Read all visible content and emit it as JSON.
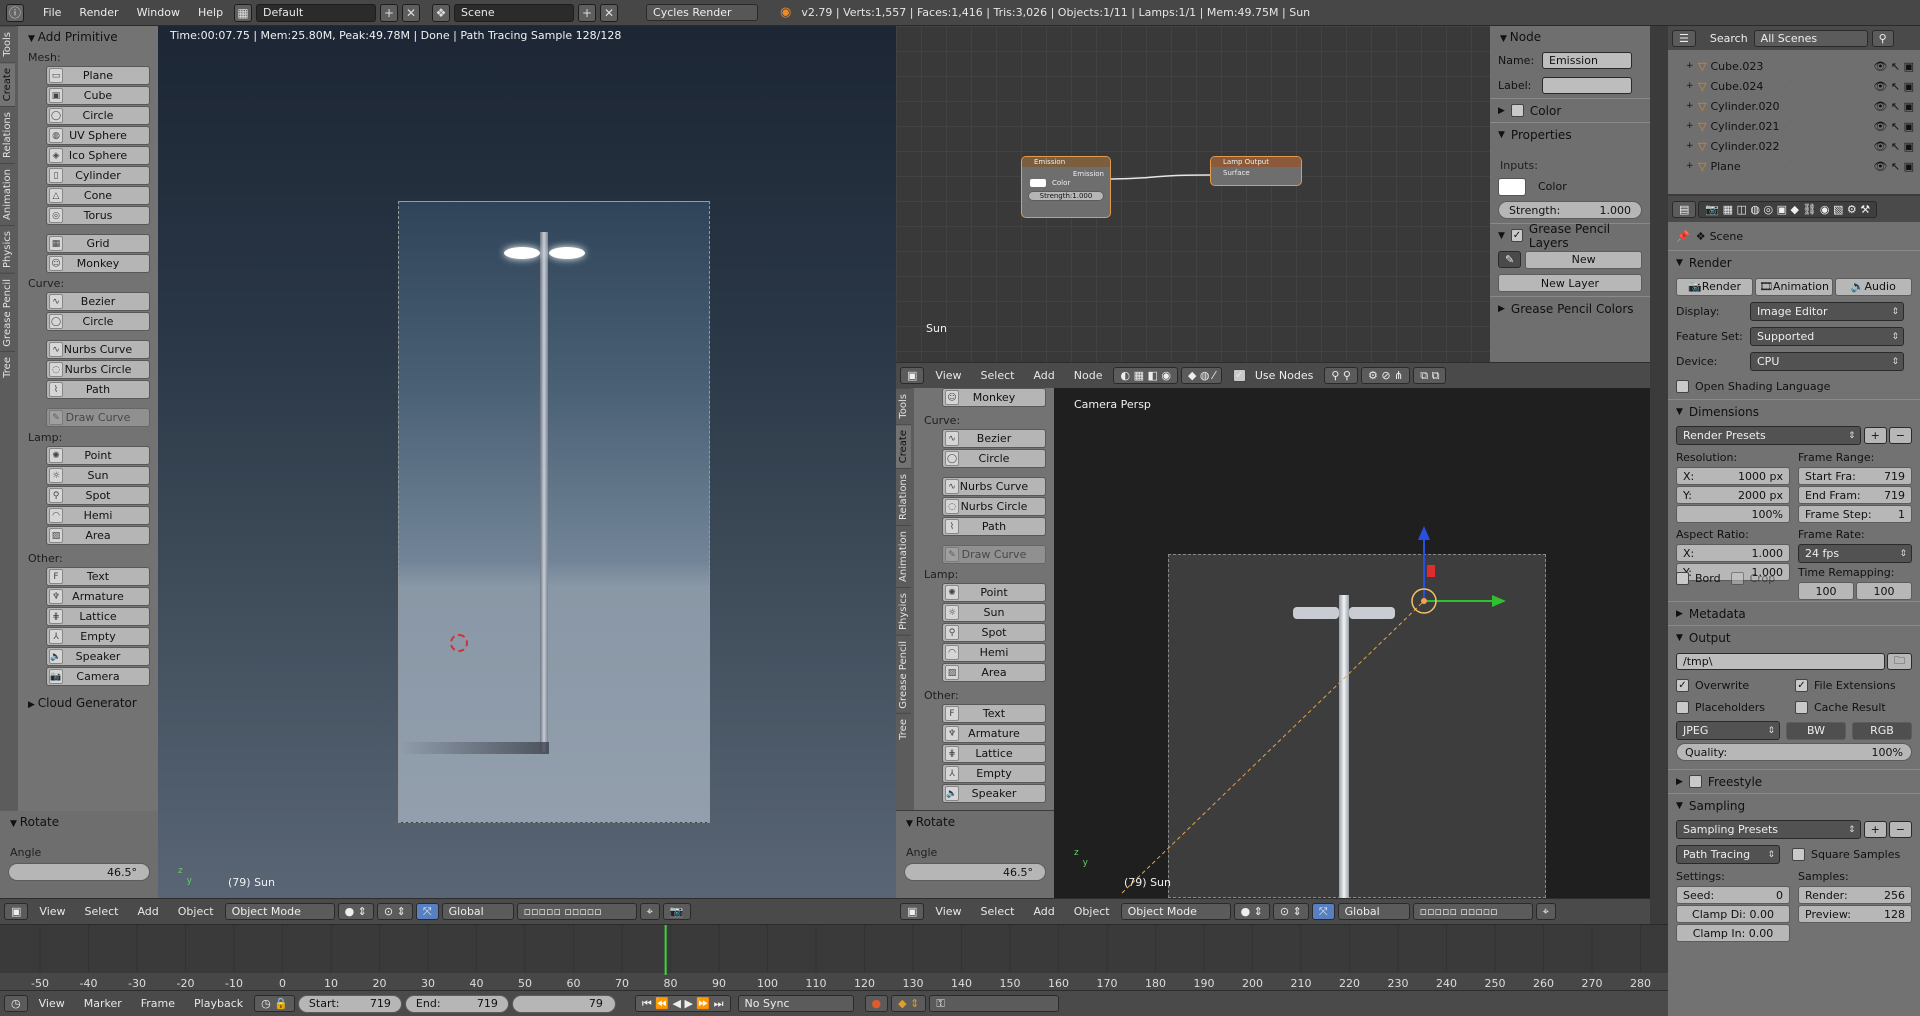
{
  "topbar": {
    "menus": [
      "File",
      "Render",
      "Window",
      "Help"
    ],
    "screen_layout": "Default",
    "scene": "Scene",
    "engine": "Cycles Render",
    "stats": "v2.79 | Verts:1,557 | Faces:1,416 | Tris:3,026 | Objects:1/11 | Lamps:1/1 | Mem:49.75M | Sun"
  },
  "left_tool_tabs": [
    "Tools",
    "Create",
    "Relations",
    "Animation",
    "Physics",
    "Grease Pencil",
    "Tree"
  ],
  "tool_panel": {
    "title": "Add Primitive",
    "mesh_label": "Mesh:",
    "mesh": [
      "Plane",
      "Cube",
      "Circle",
      "UV Sphere",
      "Ico Sphere",
      "Cylinder",
      "Cone",
      "Torus"
    ],
    "mesh2": [
      "Grid",
      "Monkey"
    ],
    "curve_label": "Curve:",
    "curve": [
      "Bezier",
      "Circle"
    ],
    "curve2": [
      "Nurbs Curve",
      "Nurbs Circle",
      "Path"
    ],
    "draw_curve": "Draw Curve",
    "lamp_label": "Lamp:",
    "lamp": [
      "Point",
      "Sun",
      "Spot",
      "Hemi",
      "Area"
    ],
    "other_label": "Other:",
    "other": [
      "Text",
      "Armature",
      "Lattice",
      "Empty",
      "Speaker",
      "Camera"
    ],
    "cloud": "Cloud Generator"
  },
  "rotate_panel": {
    "title": "Rotate",
    "angle_label": "Angle",
    "angle_value": "46.5°"
  },
  "render_view": {
    "status": "Time:00:07.75 | Mem:25.80M, Peak:49.78M | Done | Path Tracing Sample 128/128",
    "object_label": "(79) Sun"
  },
  "left_header": {
    "menus": [
      "View",
      "Select",
      "Add",
      "Object"
    ],
    "mode": "Object Mode",
    "orientation": "Global"
  },
  "node_editor": {
    "emission_node": {
      "title": "Emission",
      "output": "Emission",
      "color_label": "Color",
      "strength": "Strength:1.000"
    },
    "lamp_output": {
      "title": "Lamp Output",
      "input": "Surface"
    },
    "label": "Sun"
  },
  "node_side": {
    "node_title": "Node",
    "name_label": "Name:",
    "name_value": "Emission",
    "label_label": "Label:",
    "label_value": "",
    "color_section": "Color",
    "properties_section": "Properties",
    "inputs_label": "Inputs:",
    "color_label": "Color",
    "strength": "Strength:",
    "strength_value": "1.000",
    "gp_layers": "Grease Pencil Layers",
    "new_btn": "New",
    "new_layer_btn": "New Layer",
    "gp_colors": "Grease Pencil Colors"
  },
  "node_header": {
    "menus": [
      "View",
      "Select",
      "Add",
      "Node"
    ],
    "use_nodes": "Use Nodes"
  },
  "mid_tool_tabs": [
    "Tools",
    "Create",
    "Relations",
    "Animation",
    "Physics",
    "Grease Pencil",
    "Tree"
  ],
  "mid_tool_panel": {
    "monkey": "Monkey",
    "curve_label": "Curve:",
    "curve": [
      "Bezier",
      "Circle"
    ],
    "curve2": [
      "Nurbs Curve",
      "Nurbs Circle",
      "Path"
    ],
    "draw_curve": "Draw Curve",
    "lamp_label": "Lamp:",
    "lamp": [
      "Point",
      "Sun",
      "Spot",
      "Hemi",
      "Area"
    ],
    "other_label": "Other:",
    "other": [
      "Text",
      "Armature",
      "Lattice",
      "Empty",
      "Speaker"
    ]
  },
  "camera_view": {
    "label": "Camera Persp",
    "object_label": "(79) Sun"
  },
  "mid_rotate": {
    "title": "Rotate",
    "angle_label": "Angle",
    "angle_value": "46.5°"
  },
  "mid_header": {
    "menus": [
      "View",
      "Select",
      "Add",
      "Object"
    ],
    "mode": "Object Mode",
    "orientation": "Global"
  },
  "outliner": {
    "search_label": "Search",
    "filter": "All Scenes",
    "items": [
      "Cube.023",
      "Cube.024",
      "Cylinder.020",
      "Cylinder.021",
      "Cylinder.022",
      "Plane"
    ]
  },
  "properties": {
    "context": "Scene",
    "render_section": "Render",
    "render_btn": "Render",
    "animation_btn": "Animation",
    "audio_btn": "Audio",
    "display_label": "Display:",
    "display_value": "Image Editor",
    "feature_label": "Feature Set:",
    "feature_value": "Supported",
    "device_label": "Device:",
    "device_value": "CPU",
    "osl": "Open Shading Language",
    "dimensions": "Dimensions",
    "render_presets": "Render Presets",
    "resolution_label": "Resolution:",
    "res_x": "X:",
    "res_x_val": "1000 px",
    "res_y": "Y:",
    "res_y_val": "2000 px",
    "res_pct": "100%",
    "frame_range_label": "Frame Range:",
    "start_fra": "Start Fra:",
    "start_val": "719",
    "end_fra": "End Fram:",
    "end_val": "719",
    "frame_step": "Frame Step:",
    "step_val": "1",
    "aspect_label": "Aspect Ratio:",
    "asp_x": "X:",
    "asp_x_val": "1.000",
    "asp_y": "Y:",
    "asp_y_val": "1.000",
    "frame_rate_label": "Frame Rate:",
    "frame_rate": "24 fps",
    "time_remap": "Time Remapping:",
    "remap_a": "100",
    "remap_b": "100",
    "bord": "Bord",
    "crop": "Crop",
    "metadata": "Metadata",
    "output": "Output",
    "output_path": "/tmp\\",
    "overwrite": "Overwrite",
    "file_ext": "File Extensions",
    "placeholders": "Placeholders",
    "cache_result": "Cache Result",
    "format": "JPEG",
    "bw": "BW",
    "rgb": "RGB",
    "quality": "Quality:",
    "quality_val": "100%",
    "freestyle": "Freestyle",
    "sampling": "Sampling",
    "sampling_presets": "Sampling Presets",
    "path_tracing": "Path Tracing",
    "square_samples": "Square Samples",
    "settings_label": "Settings:",
    "samples_label": "Samples:",
    "seed": "Seed:",
    "seed_val": "0",
    "render_s": "Render:",
    "render_s_val": "256",
    "clamp_di": "Clamp Di: 0.00",
    "preview": "Preview:",
    "preview_val": "128",
    "clamp_in": "Clamp In: 0.00"
  },
  "timeline": {
    "ticks": [
      "-50",
      "-40",
      "-30",
      "-20",
      "-10",
      "0",
      "10",
      "20",
      "30",
      "40",
      "50",
      "60",
      "70",
      "80",
      "90",
      "100",
      "110",
      "120",
      "130",
      "140",
      "150",
      "160",
      "170",
      "180",
      "190",
      "200",
      "210",
      "220",
      "230",
      "240",
      "250",
      "260",
      "270",
      "280"
    ],
    "current_frame": 79
  },
  "bottom_header": {
    "menus": [
      "View",
      "Marker",
      "Frame",
      "Playback"
    ],
    "start_label": "Start:",
    "start": "719",
    "end_label": "End:",
    "end": "719",
    "frame": "79",
    "sync": "No Sync"
  }
}
